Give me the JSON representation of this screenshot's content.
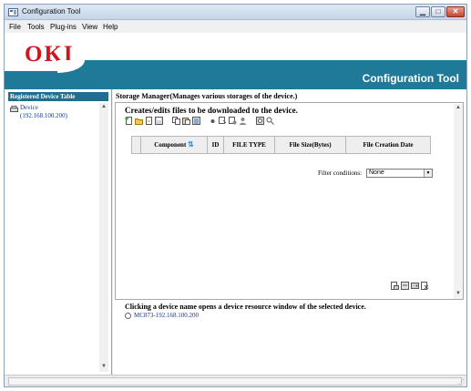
{
  "window": {
    "title": "Configuration Tool"
  },
  "menu": [
    "File",
    "Tools",
    "Plug-ins",
    "View",
    "Help"
  ],
  "banner": {
    "logo": "OKI",
    "title": "Configuration Tool"
  },
  "left_panel": {
    "header": "Registered Device Table",
    "device_name": "Device",
    "device_ip": "(192.168.100.200)"
  },
  "storage": {
    "title": "Storage Manager(Manages various storages of the device.)",
    "creates_title": "Creates/edits files to be downloaded to the device.",
    "columns": [
      "Component",
      "ID",
      "FILE TYPE",
      "File Size(Bytes)",
      "File Creation Date"
    ],
    "filter_label": "Filter conditions:",
    "filter_value": "None"
  },
  "resource": {
    "title": "Clicking a device name opens a device resource window of the selected device.",
    "device_link": "MC873-192.168.100.200"
  },
  "colors": {
    "brand_red": "#d2141c",
    "brand_teal": "#1f7a9a",
    "header_blue": "#1f6f90"
  }
}
